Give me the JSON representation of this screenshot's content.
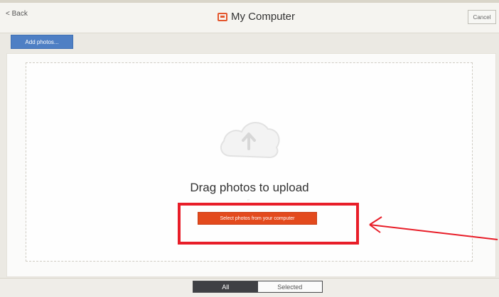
{
  "header": {
    "back_label": "< Back",
    "title": "My Computer",
    "cancel_label": "Cancel"
  },
  "toolbar": {
    "add_photos_label": "Add photos..."
  },
  "dropzone": {
    "drag_text": "Drag photos to upload",
    "select_label": "Select photos from your computer"
  },
  "footer": {
    "tabs": [
      {
        "label": "All"
      },
      {
        "label": "Selected"
      }
    ]
  },
  "colors": {
    "accent_red": "#e34a1d",
    "accent_blue": "#4e7fc4",
    "highlight": "#e81d28"
  },
  "icons": {
    "back": "chevron-left-icon",
    "title": "folder-icon",
    "upload": "cloud-upload-icon",
    "annotation": "arrow-icon"
  }
}
